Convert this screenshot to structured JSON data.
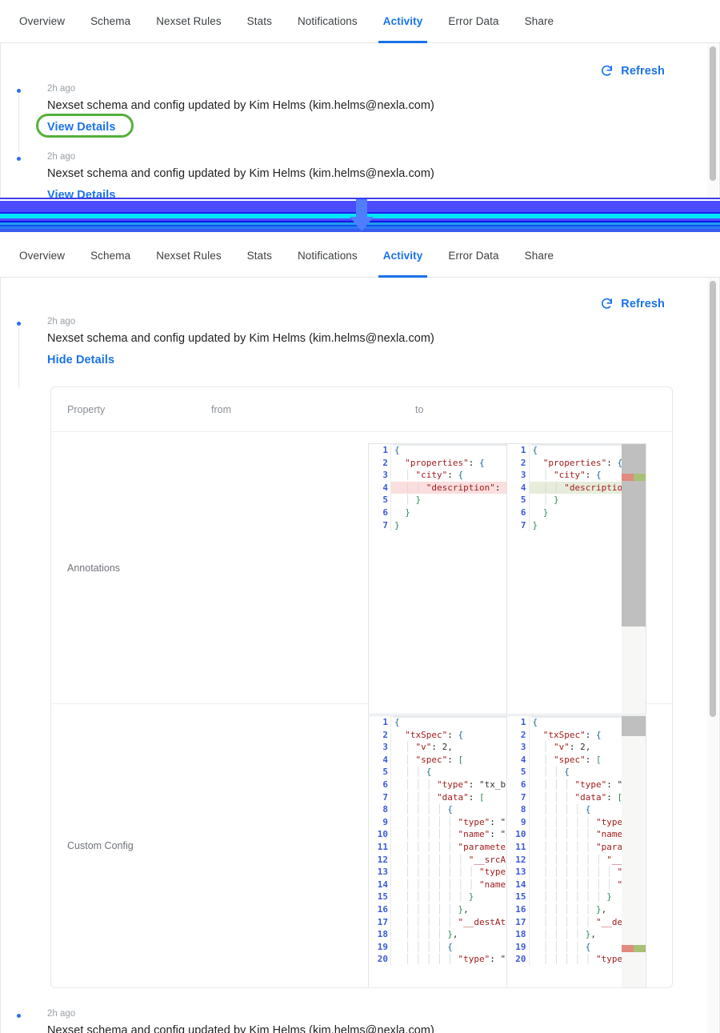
{
  "tabs": [
    {
      "label": "Overview",
      "active": false
    },
    {
      "label": "Schema",
      "active": false
    },
    {
      "label": "Nexset Rules",
      "active": false
    },
    {
      "label": "Stats",
      "active": false
    },
    {
      "label": "Notifications",
      "active": false
    },
    {
      "label": "Activity",
      "active": true
    },
    {
      "label": "Error Data",
      "active": false
    },
    {
      "label": "Share",
      "active": false
    }
  ],
  "toolbar": {
    "refresh_label": "Refresh",
    "refresh_icon": "refresh-icon"
  },
  "accent_color": "#1a73e8",
  "highlight_color": "#55b03a",
  "before": {
    "activities": [
      {
        "timestamp": "2h ago",
        "message": "Nexset schema and config updated by Kim Helms (kim.helms@nexla.com)",
        "action_label": "View Details"
      },
      {
        "timestamp": "2h ago",
        "message": "Nexset schema and config updated by Kim Helms (kim.helms@nexla.com)",
        "action_label": "View Details"
      }
    ]
  },
  "after": {
    "activities": [
      {
        "timestamp": "2h ago",
        "message": "Nexset schema and config updated by Kim Helms (kim.helms@nexla.com)",
        "action_label": "Hide Details"
      },
      {
        "timestamp": "2h ago",
        "message": "Nexset schema and config updated by Kim Helms (kim.helms@nexla.com)",
        "action_label": ""
      }
    ],
    "diff_table": {
      "columns": {
        "property": "Property",
        "from": "from",
        "to": "to"
      },
      "rows": [
        {
          "label": "Annotations",
          "from_lines": [
            {
              "no": "1",
              "text": "{",
              "change": "none"
            },
            {
              "no": "2",
              "text": "  \"properties\": {",
              "change": "none"
            },
            {
              "no": "3",
              "text": "    \"city\": {",
              "change": "none"
            },
            {
              "no": "4",
              "text": "      \"description\": \"City recorded ",
              "change": "del"
            },
            {
              "no": "5",
              "text": "    }",
              "change": "none"
            },
            {
              "no": "6",
              "text": "  }",
              "change": "none"
            },
            {
              "no": "7",
              "text": "}",
              "change": "none"
            }
          ],
          "to_lines": [
            {
              "no": "1",
              "text": "{",
              "change": "none"
            },
            {
              "no": "2",
              "text": "  \"properties\": {",
              "change": "none"
            },
            {
              "no": "3",
              "text": "    \"city\": {",
              "change": "none"
            },
            {
              "no": "4",
              "text": "      \"description\": \"City recorded f",
              "change": "ins"
            },
            {
              "no": "5",
              "text": "    }",
              "change": "none"
            },
            {
              "no": "6",
              "text": "  }",
              "change": "none"
            },
            {
              "no": "7",
              "text": "}",
              "change": "none"
            }
          ]
        },
        {
          "label": "Custom Config",
          "from_lines": [
            {
              "no": "1",
              "text": "{",
              "change": "none"
            },
            {
              "no": "2",
              "text": "  \"txSpec\": {",
              "change": "none"
            },
            {
              "no": "3",
              "text": "    \"v\": 2,",
              "change": "none"
            },
            {
              "no": "4",
              "text": "    \"spec\": [",
              "change": "none"
            },
            {
              "no": "5",
              "text": "      {",
              "change": "none"
            },
            {
              "no": "6",
              "text": "        \"type\": \"tx_builder\",",
              "change": "none"
            },
            {
              "no": "7",
              "text": "        \"data\": [",
              "change": "none"
            },
            {
              "no": "8",
              "text": "          {",
              "change": "none"
            },
            {
              "no": "9",
              "text": "            \"type\": \"function\",",
              "change": "none"
            },
            {
              "no": "10",
              "text": "            \"name\": \"eqAttr\",",
              "change": "none"
            },
            {
              "no": "11",
              "text": "            \"parameters\": {",
              "change": "none"
            },
            {
              "no": "12",
              "text": "              \"__srcAttr\": {",
              "change": "none"
            },
            {
              "no": "13",
              "text": "                \"type\": \"attributeRe",
              "change": "none"
            },
            {
              "no": "14",
              "text": "                \"name\": \"cc_type\"",
              "change": "none"
            },
            {
              "no": "15",
              "text": "              }",
              "change": "none"
            },
            {
              "no": "16",
              "text": "            },",
              "change": "none"
            },
            {
              "no": "17",
              "text": "            \"__destAttr\": \"cc_type\"",
              "change": "none"
            },
            {
              "no": "18",
              "text": "          },",
              "change": "none"
            },
            {
              "no": "19",
              "text": "          {",
              "change": "none"
            },
            {
              "no": "20",
              "text": "            \"type\": \"function\"",
              "change": "none"
            }
          ],
          "to_lines": [
            {
              "no": "1",
              "text": "{",
              "change": "none"
            },
            {
              "no": "2",
              "text": "  \"txSpec\": {",
              "change": "none"
            },
            {
              "no": "3",
              "text": "    \"v\": 2,",
              "change": "none"
            },
            {
              "no": "4",
              "text": "    \"spec\": [",
              "change": "none"
            },
            {
              "no": "5",
              "text": "      {",
              "change": "none"
            },
            {
              "no": "6",
              "text": "        \"type\": \"tx_builder\",",
              "change": "none"
            },
            {
              "no": "7",
              "text": "        \"data\": [",
              "change": "none"
            },
            {
              "no": "8",
              "text": "          {",
              "change": "none"
            },
            {
              "no": "9",
              "text": "            \"type\": \"function\",",
              "change": "none"
            },
            {
              "no": "10",
              "text": "            \"name\": \"eqAttr\",",
              "change": "none"
            },
            {
              "no": "11",
              "text": "            \"parameters\": {",
              "change": "none"
            },
            {
              "no": "12",
              "text": "              \"__srcAttr\": {",
              "change": "none"
            },
            {
              "no": "13",
              "text": "                \"type\": \"attributeRe",
              "change": "none"
            },
            {
              "no": "14",
              "text": "                \"name\": \"cc_type\"",
              "change": "none"
            },
            {
              "no": "15",
              "text": "              }",
              "change": "none"
            },
            {
              "no": "16",
              "text": "            },",
              "change": "none"
            },
            {
              "no": "17",
              "text": "            \"__destAttr\": \"cc_type\"",
              "change": "none"
            },
            {
              "no": "18",
              "text": "          },",
              "change": "none"
            },
            {
              "no": "19",
              "text": "          {",
              "change": "none"
            },
            {
              "no": "20",
              "text": "            \"type\": \"function\"",
              "change": "none"
            }
          ]
        }
      ]
    }
  }
}
